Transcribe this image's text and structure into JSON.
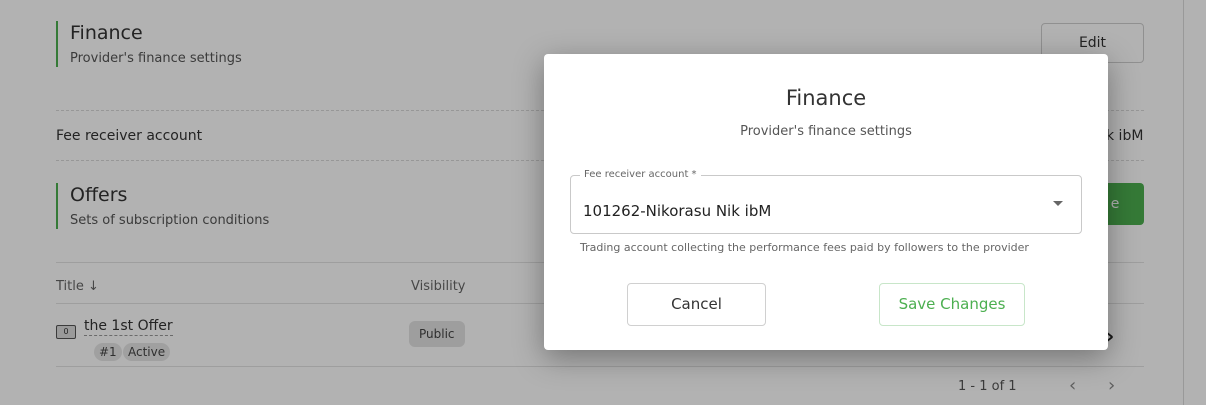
{
  "finance": {
    "title": "Finance",
    "subtitle": "Provider's finance settings",
    "edit_label": "Edit",
    "fee_label": "Fee receiver account",
    "fee_value_partial": "k ibM"
  },
  "offers": {
    "title": "Offers",
    "subtitle": "Sets of subscription conditions",
    "action_partial": "e",
    "columns": [
      "Title",
      "Visibility"
    ],
    "sort_icon": "arrow-down-icon",
    "rows": [
      {
        "icon_text": "0",
        "title": "the 1st Offer",
        "number": "#1",
        "status": "Active",
        "visibility": "Public"
      }
    ],
    "pagination": {
      "range": "1 - 1 of 1"
    }
  },
  "dialog": {
    "title": "Finance",
    "subtitle": "Provider's finance settings",
    "field_label": "Fee receiver account *",
    "field_value": "101262-Nikorasu Nik ibM",
    "field_help": "Trading account collecting the performance fees paid by followers to the provider",
    "cancel_label": "Cancel",
    "save_label": "Save Changes"
  },
  "colors": {
    "accent": "#4caf50",
    "overlay": "rgba(0,0,0,0.30)"
  }
}
